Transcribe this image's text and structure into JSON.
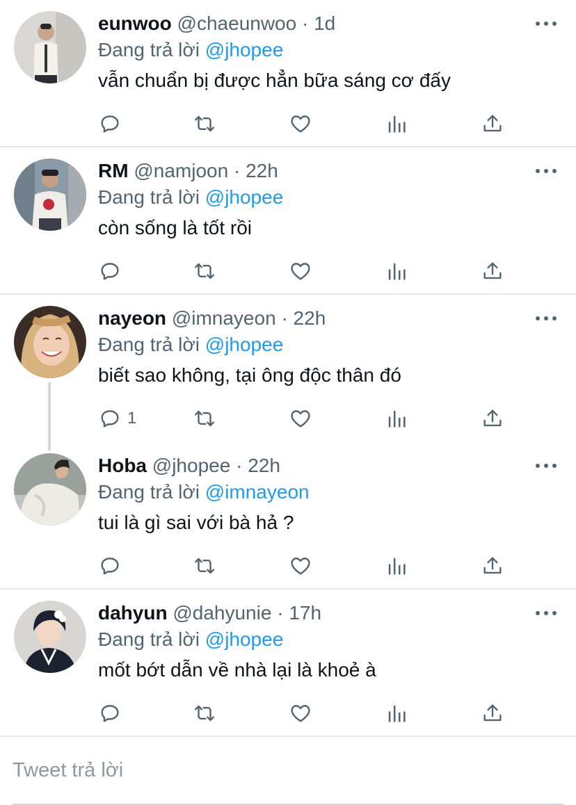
{
  "tweets": [
    {
      "name": "eunwoo",
      "handle": "@chaeunwoo",
      "dot": "·",
      "time": "1d",
      "reply_prefix": "Đang trả lời",
      "reply_to": "@jhopee",
      "text": "vẫn chuẩn bị được hẳn bữa sáng cơ đấy",
      "reply_count": ""
    },
    {
      "name": "RM",
      "handle": "@namjoon",
      "dot": "·",
      "time": "22h",
      "reply_prefix": "Đang trả lời",
      "reply_to": "@jhopee",
      "text": "còn sống là tốt rồi",
      "reply_count": ""
    },
    {
      "name": "nayeon",
      "handle": "@imnayeon",
      "dot": "·",
      "time": "22h",
      "reply_prefix": "Đang trả lời",
      "reply_to": "@jhopee",
      "text": "biết sao không, tại ông độc thân đó",
      "reply_count": "1"
    },
    {
      "name": "Hoba",
      "handle": "@jhopee",
      "dot": "·",
      "time": "22h",
      "reply_prefix": "Đang trả lời",
      "reply_to": "@imnayeon",
      "text": "tui là gì sai với bà hả ?",
      "reply_count": ""
    },
    {
      "name": "dahyun",
      "handle": "@dahyunie",
      "dot": "·",
      "time": "17h",
      "reply_prefix": "Đang trả lời",
      "reply_to": "@jhopee",
      "text": "mốt bớt dẫn về nhà lại là khoẻ à",
      "reply_count": ""
    }
  ],
  "reply_box": {
    "placeholder": "Tweet trả lời"
  },
  "icons": {
    "reply": "reply-icon",
    "retweet": "retweet-icon",
    "like": "heart-icon",
    "views": "analytics-icon",
    "share": "share-icon",
    "more": "more-icon"
  },
  "colors": {
    "mention": "#1d9bf0",
    "secondary_text": "#536471",
    "primary_text": "#0f1419",
    "divider": "#e7e9ea"
  }
}
